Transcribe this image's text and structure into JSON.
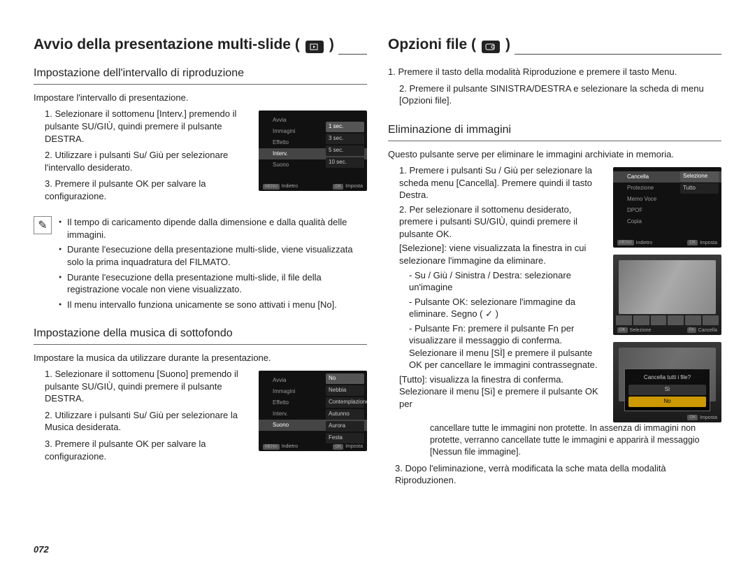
{
  "pageNumber": "072",
  "left": {
    "title": "Avvio della presentazione multi-slide (",
    "titleEnd": ")",
    "s1": {
      "heading": "Impostazione dell'intervallo di riproduzione",
      "intro": "Impostare l'intervallo di presentazione.",
      "steps": [
        "1. Selezionare il sottomenu [Interv.] premendo il pulsante SU/GIÙ, quindi premere il pulsante DESTRA.",
        "2. Utilizzare i pulsanti Su/ Giù per selezionare l'intervallo desiderato.",
        "3. Premere il pulsante OK per salvare la configurazione."
      ],
      "lcd": {
        "items": [
          "Avvia",
          "Immagini",
          "Effetto",
          "Interv.",
          "Suono"
        ],
        "selIndex": 3,
        "options": [
          "1 sec.",
          "3 sec.",
          "5 sec.",
          "10 sec."
        ],
        "optSelIndex": 0,
        "footL": "Indietro",
        "footR": "Imposta"
      }
    },
    "note": [
      "Il tempo di caricamento dipende dalla dimensione e dalla qualità delle immagini.",
      "Durante l'esecuzione della presentazione multi-slide, viene visualizzata solo la prima inquadratura del FILMATO.",
      "Durante l'esecuzione della presentazione multi-slide, il file della registrazione vocale non viene visualizzato.",
      "Il menu intervallo funziona unicamente se sono attivati i menu [No]."
    ],
    "s2": {
      "heading": "Impostazione della musica di sottofondo",
      "intro": "Impostare la musica da utilizzare durante la presentazione.",
      "steps": [
        "1. Selezionare il sottomenu [Suono] premendo il pulsante SU/GIÙ, quindi premere il pulsante DESTRA.",
        "2. Utilizzare i pulsanti Su/ Giù per selezionare la Musica desiderata.",
        "3. Premere il pulsante OK per salvare la configurazione."
      ],
      "lcd": {
        "items": [
          "Avvia",
          "Immagini",
          "Effetto",
          "Interv.",
          "Suono"
        ],
        "selIndex": 4,
        "options": [
          "No",
          "Nebbia",
          "Contemplazione",
          "Autunno",
          "Aurora",
          "Festa"
        ],
        "optSelIndex": 0,
        "footL": "Indietro",
        "footR": "Imposta"
      }
    }
  },
  "right": {
    "title": "Opzioni file (",
    "titleEnd": ")",
    "intro": [
      "1. Premere il tasto della modalità Riproduzione e premere il tasto Menu.",
      "2. Premere il pulsante SINISTRA/DESTRA e selezionare la scheda di menu [Opzioni file]."
    ],
    "s1": {
      "heading": "Eliminazione di immagini",
      "intro": "Questo pulsante serve per eliminare le immagini archiviate in memoria.",
      "blockA": [
        "1. Premere i pulsanti Su / Giù per selezionare la scheda menu [Cancella]. Premere quindi il tasto Destra.",
        "2. Per selezionare il sottomenu desiderato, premere i pulsanti SU/GIÙ, quindi premere il pulsante OK.",
        "[Selezione]: viene visualizzata la finestra in cui selezionare l'immagine da eliminare.",
        "- Su / Giù / Sinistra / Destra: selezionare un'imagine",
        "- Pulsante OK: selezionare l'immagine da eliminare. Segno ( ✓ )",
        "- Pulsante Fn: premere il pulsante Fn per visualizzare il messaggio di conferma. Selezionare il menu [SÌ] e premere il pulsante OK per cancellare le immagini contrassegnate.",
        "[Tutto]: visualizza la finestra di conferma. Selezionare il menu [Sì] e premere il pulsante OK per"
      ],
      "tail": "cancellare tutte le immagini non protette. In assenza di immagini non protette, verranno cancellate tutte le immagini e apparirà il messaggio  [Nessun file immagine].",
      "step3": "3. Dopo l'eliminazione, verrà modificata la sche mata della modalità Riproduzionen.",
      "lcd1": {
        "items": [
          "Cancella",
          "Protezione",
          "Memo Voce",
          "DPOF",
          "Copia"
        ],
        "selIndex": 0,
        "options": [
          "Selezione",
          "Tutto"
        ],
        "optSelIndex": 0,
        "footL": "Indietro",
        "footR": "Imposta"
      },
      "lcd2": {
        "footL": "Selezione",
        "footR": "Cancella"
      },
      "lcd3": {
        "question": "Cancella tutti i file?",
        "opts": [
          "Sì",
          "No"
        ],
        "sel": 1,
        "footR": "Imposta"
      }
    }
  }
}
